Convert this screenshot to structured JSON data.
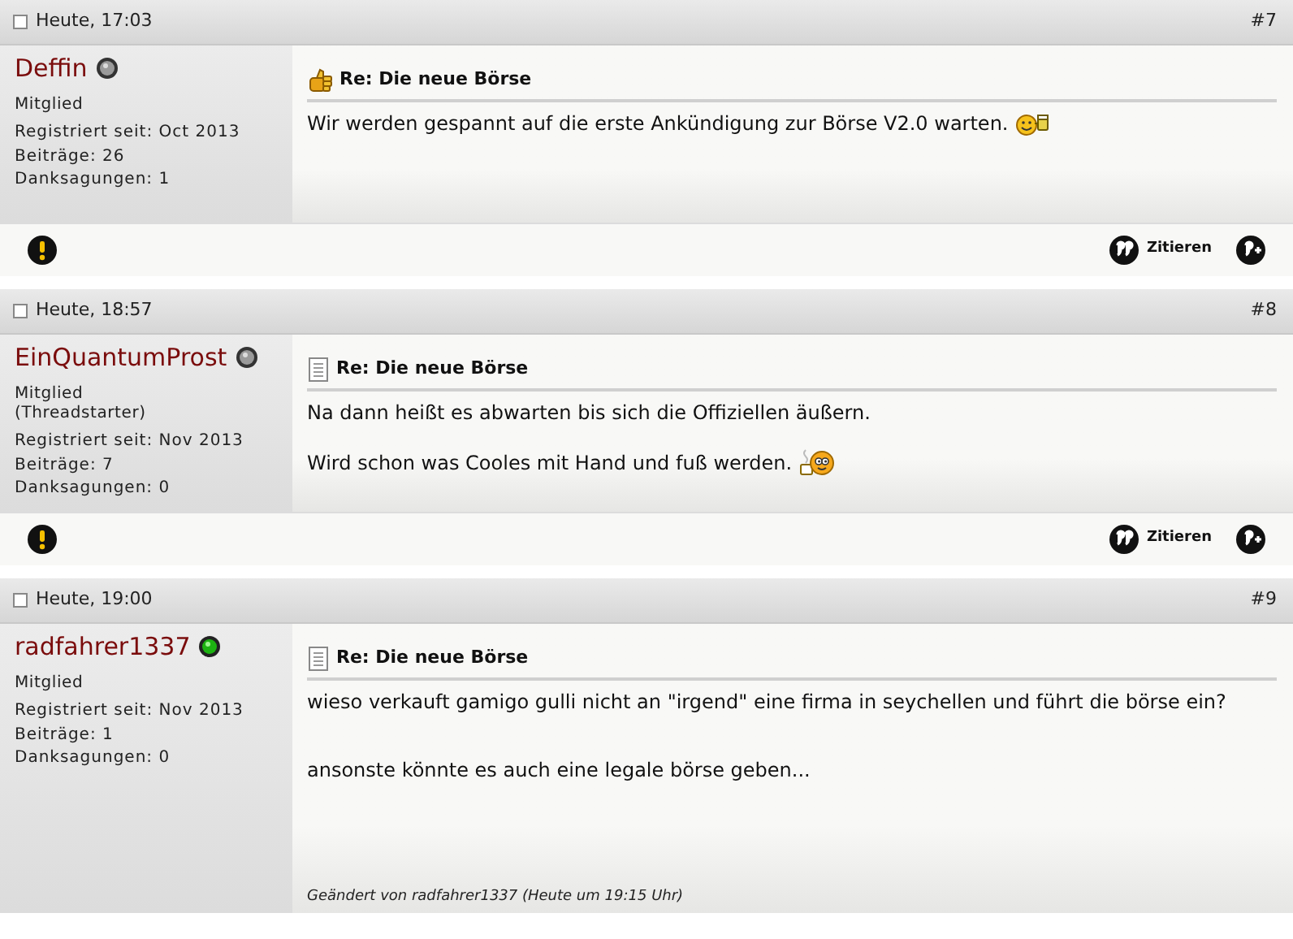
{
  "posts": [
    {
      "date": "Heute, 17:03",
      "number": "#7",
      "user": {
        "name": "Deffin",
        "online": false,
        "rank": "Mitglied",
        "registered": "Registriert seit: Oct 2013",
        "posts": "Beiträge: 26",
        "thanks": "Danksagungen: 1"
      },
      "kind": "thumbs",
      "title": "Re: Die neue Börse",
      "paragraphs": [
        {
          "text": "Wir werden gespannt auf die erste Ankündigung zur Börse V2.0 warten.",
          "kind": "beer"
        }
      ],
      "footer": {
        "quote_label": "Zitieren"
      }
    },
    {
      "date": "Heute, 18:57",
      "number": "#8",
      "user": {
        "name": "EinQuantumProst",
        "online": false,
        "rank": "Mitglied",
        "rank_note": "(Threadstarter)",
        "registered": "Registriert seit: Nov 2013",
        "posts": "Beiträge: 7",
        "thanks": "Danksagungen: 0"
      },
      "kind": "document",
      "title": "Re: Die neue Börse",
      "paragraphs": [
        {
          "text": "Na dann heißt es abwarten bis sich die Offiziellen äußern."
        },
        {
          "text": "Wird schon was Cooles mit Hand und fuß werden.",
          "kind": "coffee"
        }
      ],
      "footer": {
        "quote_label": "Zitieren"
      }
    },
    {
      "date": "Heute, 19:00",
      "number": "#9",
      "user": {
        "name": "radfahrer1337",
        "online": true,
        "rank": "Mitglied",
        "registered": "Registriert seit: Nov 2013",
        "posts": "Beiträge: 1",
        "thanks": "Danksagungen: 0"
      },
      "kind": "document",
      "title": "Re: Die neue Börse",
      "paragraphs": [
        {
          "text": "wieso verkauft gamigo gulli nicht an \"irgend\" eine firma in seychellen und führt die börse ein?"
        },
        {
          "text": "ansonste könnte es auch eine legale börse geben..."
        }
      ],
      "edit_note": "Geändert von radfahrer1337 (Heute um 19:15 Uhr)"
    }
  ]
}
